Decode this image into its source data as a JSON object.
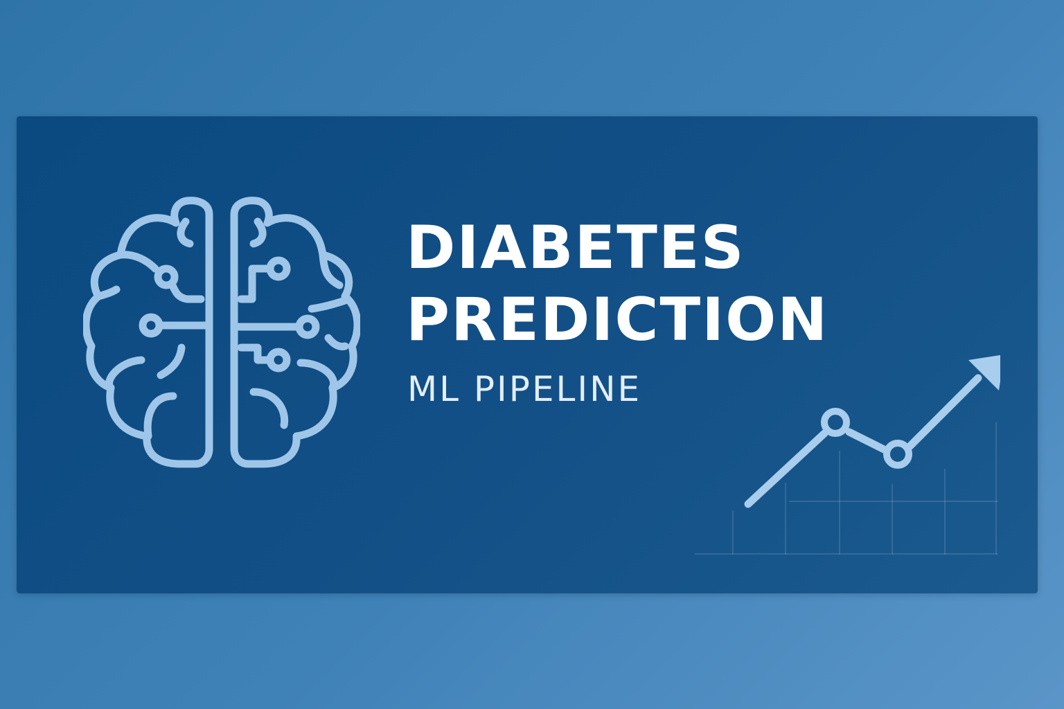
{
  "banner": {
    "title_line1": "DIABETES",
    "title_line2": "PREDICTION",
    "subtitle": "ML PIPELINE"
  },
  "icons": {
    "brain": "brain-circuit-icon",
    "chart": "trending-up-chart-icon"
  },
  "colors": {
    "background": "#3f82b8",
    "banner": "#124f86",
    "accent": "#9fc6e8",
    "title": "#ffffff"
  }
}
